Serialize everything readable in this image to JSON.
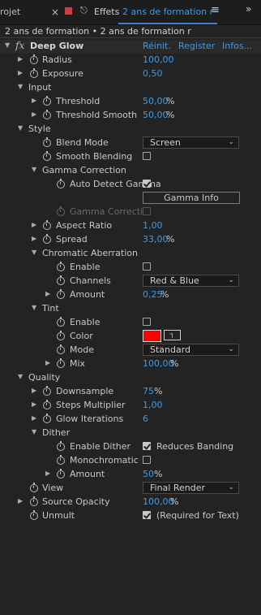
{
  "tabbar": {
    "project_tab": "rojet",
    "close_glyph": "×",
    "effects_tab": "Effets",
    "comp_tab": "2 ans de formation r",
    "menu_glyph": "≡",
    "more_glyph": "»"
  },
  "breadcrumb": "2 ans de formation • 2 ans de formation r",
  "effect": {
    "name": "Deep Glow",
    "fx_glyph": "fx",
    "reset_label": "Réinit.",
    "register_label": "Register",
    "info_label": "Infos..."
  },
  "params": {
    "radius": {
      "label": "Radius",
      "value": "100,00"
    },
    "exposure": {
      "label": "Exposure",
      "value": "0,50"
    },
    "input": {
      "label": "Input"
    },
    "threshold": {
      "label": "Threshold",
      "value": "50,00",
      "unit": "%"
    },
    "threshold_smooth": {
      "label": "Threshold Smooth",
      "value": "50,00",
      "unit": "%"
    },
    "style": {
      "label": "Style"
    },
    "blend_mode": {
      "label": "Blend Mode",
      "value": "Screen"
    },
    "smooth_blending": {
      "label": "Smooth Blending",
      "checked": false
    },
    "gamma_correction": {
      "label": "Gamma Correction"
    },
    "auto_detect_gamma": {
      "label": "Auto Detect Gamma",
      "checked": true
    },
    "gamma_info": {
      "label": "Gamma Info"
    },
    "gamma_correct": {
      "label": "Gamma Correcti",
      "checked": false
    },
    "aspect_ratio": {
      "label": "Aspect Ratio",
      "value": "1,00"
    },
    "spread": {
      "label": "Spread",
      "value": "33,00",
      "unit": "%"
    },
    "chromatic_aberration": {
      "label": "Chromatic Aberration"
    },
    "ca_enable": {
      "label": "Enable",
      "checked": false
    },
    "ca_channels": {
      "label": "Channels",
      "value": "Red & Blue"
    },
    "ca_amount": {
      "label": "Amount",
      "value": "0,25",
      "unit": "%"
    },
    "tint": {
      "label": "Tint"
    },
    "tint_enable": {
      "label": "Enable",
      "checked": false
    },
    "tint_color": {
      "label": "Color",
      "swatch": "#ff0000"
    },
    "tint_mode": {
      "label": "Mode",
      "value": "Standard"
    },
    "tint_mix": {
      "label": "Mix",
      "value": "100,00",
      "unit": "%"
    },
    "quality": {
      "label": "Quality"
    },
    "downsample": {
      "label": "Downsample",
      "value": "75",
      "unit": "%"
    },
    "steps_multiplier": {
      "label": "Steps Multiplier",
      "value": "1,00"
    },
    "glow_iterations": {
      "label": "Glow Iterations",
      "value": "6"
    },
    "dither": {
      "label": "Dither"
    },
    "enable_dither": {
      "label": "Enable Dither",
      "checked": true,
      "note": "Reduces Banding"
    },
    "monochromatic": {
      "label": "Monochromatic",
      "checked": false
    },
    "dither_amount": {
      "label": "Amount",
      "value": "50",
      "unit": "%"
    },
    "view": {
      "label": "View",
      "value": "Final Render"
    },
    "source_opacity": {
      "label": "Source Opacity",
      "value": "100,00",
      "unit": "%"
    },
    "unmult": {
      "label": "Unmult",
      "checked": true,
      "note": "(Required for Text)"
    }
  },
  "icons": {
    "expanded": "▼",
    "collapsed": "▶",
    "chevron": "⌄",
    "eyedropper": "⟞",
    "lock": "🔓"
  },
  "colors": {
    "accent_blue": "#3d9ae8",
    "tint_color": "#ff0000"
  }
}
